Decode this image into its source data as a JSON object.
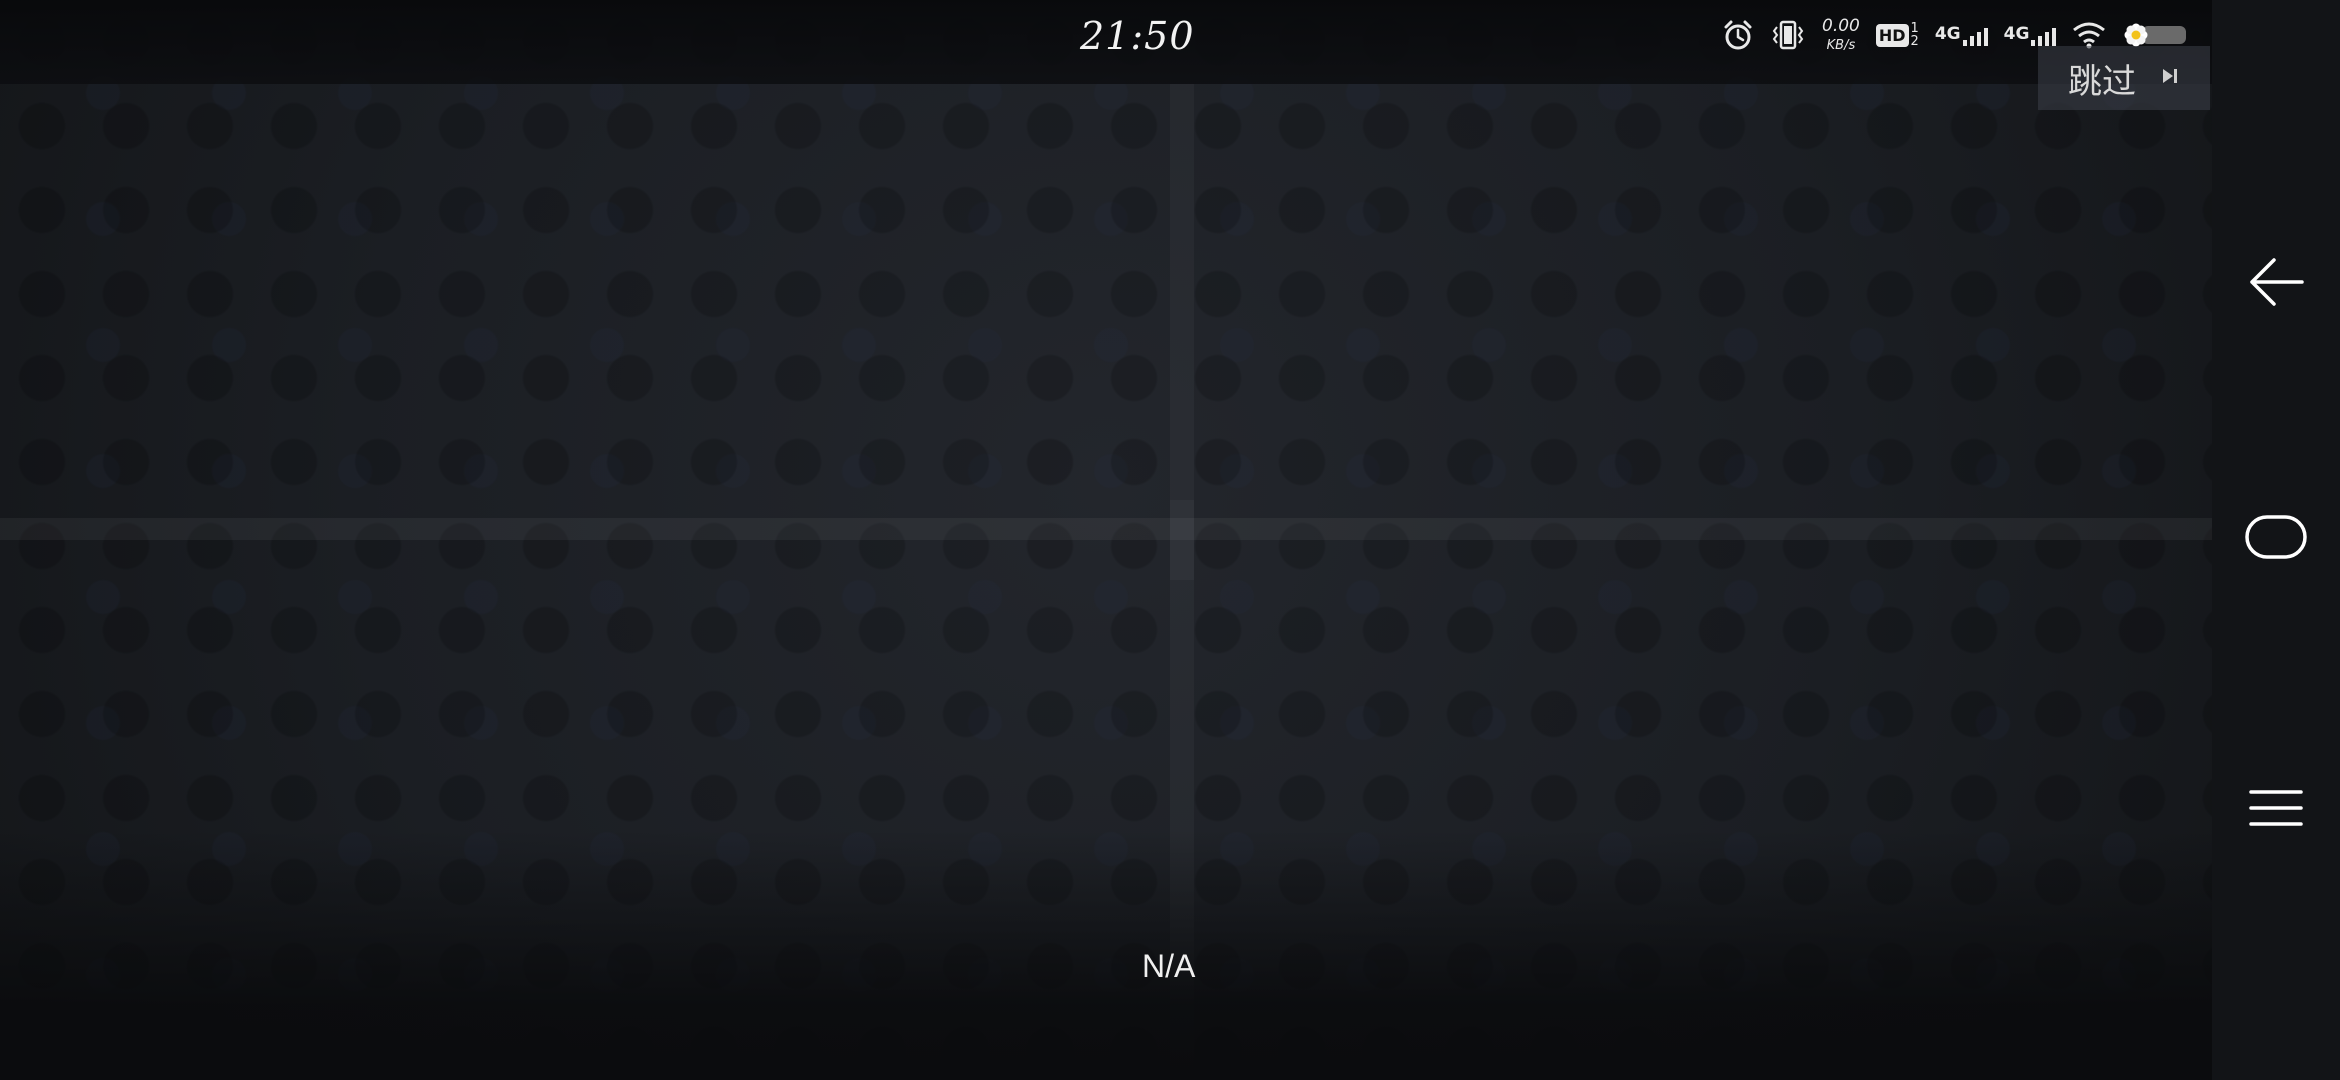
{
  "status_bar": {
    "time": "21:50",
    "network_speed_value": "0.00",
    "network_speed_unit": "KB/s",
    "hd_label": "HD",
    "hd_sim_1": "1",
    "hd_sim_2": "2",
    "sim1_network": "4G",
    "sim2_network": "4G",
    "icons": [
      "alarm-icon",
      "vibrate-icon",
      "wifi-icon",
      "battery-flower-icon"
    ]
  },
  "player": {
    "skip_label": "跳过",
    "skip_icon": "skip-next-icon",
    "center_label": "N/A"
  },
  "navigation": {
    "buttons": [
      "back-icon",
      "home-icon",
      "menu-icon"
    ]
  },
  "colors": {
    "background": "#1b1e23",
    "nav_bar": "#121417",
    "text": "#f0f0f0"
  }
}
